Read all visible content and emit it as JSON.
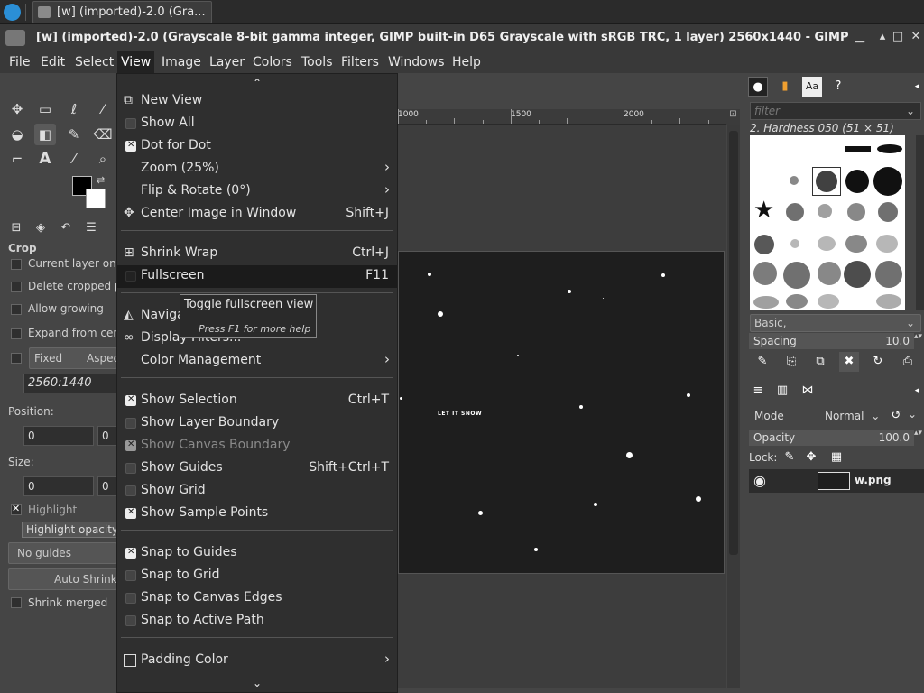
{
  "taskbar": {
    "task_title": "[w] (imported)-2.0 (Gra..."
  },
  "window": {
    "title": "[w] (imported)-2.0 (Grayscale 8-bit gamma integer, GIMP built-in D65 Grayscale with sRGB TRC, 1 layer) 2560x1440 - GIMP"
  },
  "menubar": [
    "File",
    "Edit",
    "Select",
    "View",
    "Image",
    "Layer",
    "Colors",
    "Tools",
    "Filters",
    "Windows",
    "Help"
  ],
  "tool_options": {
    "title": "Crop",
    "current_layer_only": "Current layer only",
    "delete_cropped": "Delete cropped p",
    "allow_growing": "Allow growing",
    "expand_from_center": "Expand from cent",
    "fixed": "Fixed",
    "aspect": "Aspec",
    "ratio": "2560:1440",
    "position_label": "Position:",
    "pos_x": "0",
    "pos_y": "0",
    "size_label": "Size:",
    "size_w": "0",
    "size_h": "0",
    "highlight": "Highlight",
    "highlight_opacity": "Highlight opacity",
    "guides": "No guides",
    "auto_shrink": "Auto Shrink",
    "shrink_merged": "Shrink merged"
  },
  "ruler": {
    "labels": [
      "1000",
      "1500",
      "2000"
    ]
  },
  "image": {
    "text": "LET IT SNOW"
  },
  "view_menu": {
    "items": [
      {
        "label": "New View",
        "accel": ""
      },
      {
        "label": "Show All",
        "accel": ""
      },
      {
        "label": "Dot for Dot",
        "accel": ""
      },
      {
        "label": "Zoom (25%)",
        "accel": ""
      },
      {
        "label": "Flip & Rotate (0°)",
        "accel": ""
      },
      {
        "label": "Center Image in Window",
        "accel": "Shift+J"
      },
      {
        "label": "Shrink Wrap",
        "accel": "Ctrl+J"
      },
      {
        "label": "Fullscreen",
        "accel": "F11"
      },
      {
        "label": "Naviga",
        "accel": ""
      },
      {
        "label": "Display Filters...",
        "accel": ""
      },
      {
        "label": "Color Management",
        "accel": ""
      },
      {
        "label": "Show Selection",
        "accel": "Ctrl+T"
      },
      {
        "label": "Show Layer Boundary",
        "accel": ""
      },
      {
        "label": "Show Canvas Boundary",
        "accel": ""
      },
      {
        "label": "Show Guides",
        "accel": "Shift+Ctrl+T"
      },
      {
        "label": "Show Grid",
        "accel": ""
      },
      {
        "label": "Show Sample Points",
        "accel": ""
      },
      {
        "label": "Snap to Guides",
        "accel": ""
      },
      {
        "label": "Snap to Grid",
        "accel": ""
      },
      {
        "label": "Snap to Canvas Edges",
        "accel": ""
      },
      {
        "label": "Snap to Active Path",
        "accel": ""
      },
      {
        "label": "Padding Color",
        "accel": ""
      }
    ]
  },
  "tooltip": {
    "text": "Toggle fullscreen view",
    "help": "Press F1 for more help"
  },
  "brushes": {
    "filter_placeholder": "filter",
    "selected": "2. Hardness 050 (51 × 51)",
    "preset": "Basic,",
    "spacing_label": "Spacing",
    "spacing_value": "10.0"
  },
  "layers": {
    "mode_label": "Mode",
    "mode_value": "Normal",
    "opacity_label": "Opacity",
    "opacity_value": "100.0",
    "lock_label": "Lock:",
    "layer_name": "w.png"
  },
  "colors": {
    "menu_bg": "#2f2f2f",
    "panel_bg": "#454545",
    "highlight": "#1b1b1b"
  }
}
